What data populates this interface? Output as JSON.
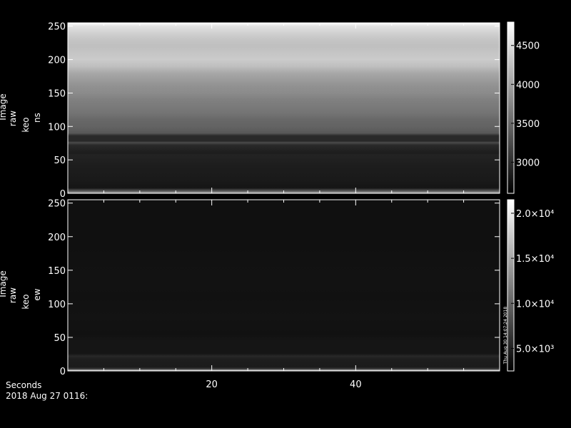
{
  "footer": {
    "xlabel": "Seconds",
    "date": "2018 Aug 27 0116:"
  },
  "chart_data": [
    {
      "type": "heatmap",
      "ylabel_lines": [
        "Image",
        "raw",
        "keo",
        "ns"
      ],
      "x_ticks": [
        20,
        40
      ],
      "xlim": [
        0,
        60
      ],
      "y_ticks": [
        0,
        50,
        100,
        150,
        200,
        250
      ],
      "ylim": [
        0,
        255
      ],
      "colorbar": {
        "range": [
          2600,
          4800
        ],
        "ticks": [
          "4500",
          "4000",
          "3500",
          "3000"
        ],
        "tick_values": [
          4500,
          4000,
          3500,
          3000
        ]
      },
      "rows": [
        {
          "y": 0,
          "v": 4100
        },
        {
          "y": 4,
          "v": 3300
        },
        {
          "y": 8,
          "v": 2780
        },
        {
          "y": 20,
          "v": 2820
        },
        {
          "y": 40,
          "v": 2850
        },
        {
          "y": 58,
          "v": 2900
        },
        {
          "y": 60,
          "v": 2850
        },
        {
          "y": 72,
          "v": 2950
        },
        {
          "y": 76,
          "v": 3250
        },
        {
          "y": 78,
          "v": 2950
        },
        {
          "y": 86,
          "v": 2950
        },
        {
          "y": 90,
          "v": 3350
        },
        {
          "y": 94,
          "v": 3400
        },
        {
          "y": 100,
          "v": 3450
        },
        {
          "y": 110,
          "v": 3500
        },
        {
          "y": 120,
          "v": 3600
        },
        {
          "y": 130,
          "v": 3650
        },
        {
          "y": 140,
          "v": 3700
        },
        {
          "y": 150,
          "v": 3800
        },
        {
          "y": 160,
          "v": 3850
        },
        {
          "y": 170,
          "v": 3950
        },
        {
          "y": 180,
          "v": 4050
        },
        {
          "y": 190,
          "v": 4250
        },
        {
          "y": 200,
          "v": 4350
        },
        {
          "y": 210,
          "v": 4300
        },
        {
          "y": 220,
          "v": 4250
        },
        {
          "y": 230,
          "v": 4300
        },
        {
          "y": 240,
          "v": 4400
        },
        {
          "y": 250,
          "v": 4550
        },
        {
          "y": 255,
          "v": 4800
        }
      ]
    },
    {
      "type": "heatmap",
      "ylabel_lines": [
        "Image",
        "raw",
        "keo",
        "ew"
      ],
      "x_ticks": [
        20,
        40
      ],
      "xlim": [
        0,
        60
      ],
      "y_ticks": [
        0,
        50,
        100,
        150,
        200,
        250
      ],
      "ylim": [
        0,
        255
      ],
      "colorbar": {
        "range": [
          3000,
          22000
        ],
        "ticks": [
          "2.0×10⁴",
          "1.5×10⁴",
          "1.0×10⁴",
          "5.0×10³"
        ],
        "tick_values": [
          20500,
          15500,
          10500,
          5500
        ]
      },
      "colorbar_note": "Thu Aug 30 14:07:24 2018",
      "rows": [
        {
          "y": 0,
          "v": 21000
        },
        {
          "y": 3,
          "v": 7000
        },
        {
          "y": 6,
          "v": 5000
        },
        {
          "y": 18,
          "v": 5200
        },
        {
          "y": 22,
          "v": 6000
        },
        {
          "y": 26,
          "v": 4600
        },
        {
          "y": 45,
          "v": 4600
        },
        {
          "y": 55,
          "v": 4300
        },
        {
          "y": 80,
          "v": 4400
        },
        {
          "y": 110,
          "v": 4300
        },
        {
          "y": 130,
          "v": 4350
        },
        {
          "y": 200,
          "v": 4200
        },
        {
          "y": 255,
          "v": 4200
        }
      ]
    }
  ]
}
